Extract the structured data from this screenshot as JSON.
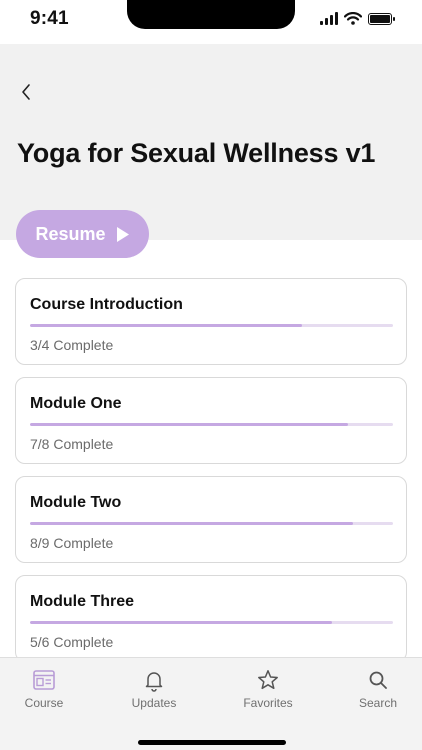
{
  "status_bar": {
    "time": "9:41"
  },
  "header": {
    "title": "Yoga for Sexual Wellness v1"
  },
  "resume": {
    "label": "Resume"
  },
  "modules": [
    {
      "title": "Course Introduction",
      "progress_text": "3/4 Complete",
      "progress": 0.75
    },
    {
      "title": "Module One",
      "progress_text": "7/8 Complete",
      "progress": 0.875
    },
    {
      "title": "Module Two",
      "progress_text": "8/9 Complete",
      "progress": 0.889
    },
    {
      "title": "Module Three",
      "progress_text": "5/6 Complete",
      "progress": 0.833
    }
  ],
  "tabs": [
    {
      "label": "Course",
      "icon": "course-icon",
      "active": true
    },
    {
      "label": "Updates",
      "icon": "bell-icon",
      "active": false
    },
    {
      "label": "Favorites",
      "icon": "star-icon",
      "active": false
    },
    {
      "label": "Search",
      "icon": "search-icon",
      "active": false
    }
  ],
  "colors": {
    "accent": "#c5a8e2",
    "header_bg": "#f1f1f1"
  }
}
